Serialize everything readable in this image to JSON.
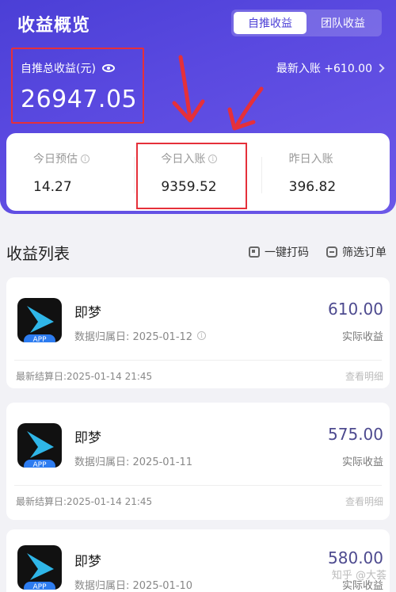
{
  "header": {
    "title": "收益概览",
    "tabs": [
      {
        "label": "自推收益",
        "active": true
      },
      {
        "label": "团队收益",
        "active": false
      }
    ]
  },
  "total": {
    "label": "自推总收益(元)",
    "value": "26947.05"
  },
  "latest_entry": {
    "label": "最新入账 +610.00"
  },
  "stats": [
    {
      "label": "今日预估",
      "value": "14.27"
    },
    {
      "label": "今日入账",
      "value": "9359.52"
    },
    {
      "label": "昨日入账",
      "value": "396.82"
    }
  ],
  "list": {
    "title": "收益列表",
    "actions": [
      "一键打码",
      "筛选订单"
    ]
  },
  "items": [
    {
      "name": "即梦",
      "tag": "APP",
      "date": "数据归属日: 2025-01-12",
      "amount": "610.00",
      "amount_label": "实际收益",
      "settle": "最新结算日:2025-01-14 21:45",
      "detail": "查看明细"
    },
    {
      "name": "即梦",
      "tag": "APP",
      "date": "数据归属日: 2025-01-11",
      "amount": "575.00",
      "amount_label": "实际收益",
      "settle": "最新结算日:2025-01-14 21:45",
      "detail": "查看明细"
    },
    {
      "name": "即梦",
      "tag": "APP",
      "date": "数据归属日: 2025-01-10",
      "amount": "580.00",
      "amount_label": "实际收益"
    }
  ],
  "watermark": "知乎 @大荟",
  "colors": {
    "header": "#5a49e0",
    "annotation": "#e5303a",
    "amount": "#4d4a8f"
  }
}
